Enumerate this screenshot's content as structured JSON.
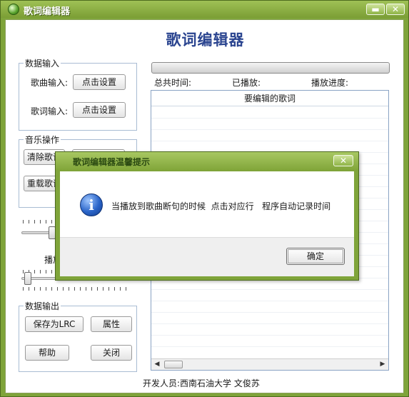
{
  "window": {
    "title": "歌词编辑器",
    "minimize_glyph": "▬",
    "close_glyph": "✕",
    "app_icon": "green-orb-icon"
  },
  "main": {
    "heading": "歌词编辑器"
  },
  "data_input": {
    "group_label": "数据输入",
    "song_label": "歌曲输入:",
    "song_button": "点击设置",
    "lyrics_label": "歌词输入:",
    "lyrics_button": "点击设置"
  },
  "music_ops": {
    "group_label": "音乐操作",
    "clear_button": "清除歌词",
    "reload_button": "重载歌词",
    "playback_label": "播放"
  },
  "data_output": {
    "group_label": "数据输出",
    "save_lrc_button": "保存为LRC",
    "properties_button": "属性",
    "help_button": "帮助",
    "close_button": "关闭"
  },
  "status": {
    "total_time_label": "总共时间:",
    "played_label": "已播放:",
    "progress_label": "播放进度:"
  },
  "lyrics_list": {
    "header": "要编辑的歌词",
    "left_arrow": "◀",
    "right_arrow": "▶"
  },
  "footer": {
    "credits": "开发人员:西南石油大学   文俊苏"
  },
  "dialog": {
    "title": "歌词编辑器温馨提示",
    "close_glyph": "✕",
    "icon": "information-icon",
    "icon_glyph": "i",
    "message": "当播放到歌曲断句的时候  点击对应行   程序自动记录时间",
    "ok_button": "确定"
  },
  "colors": {
    "chrome_green": "#7fa43a",
    "heading_blue": "#2b4590",
    "group_border": "#a9bcd3"
  }
}
